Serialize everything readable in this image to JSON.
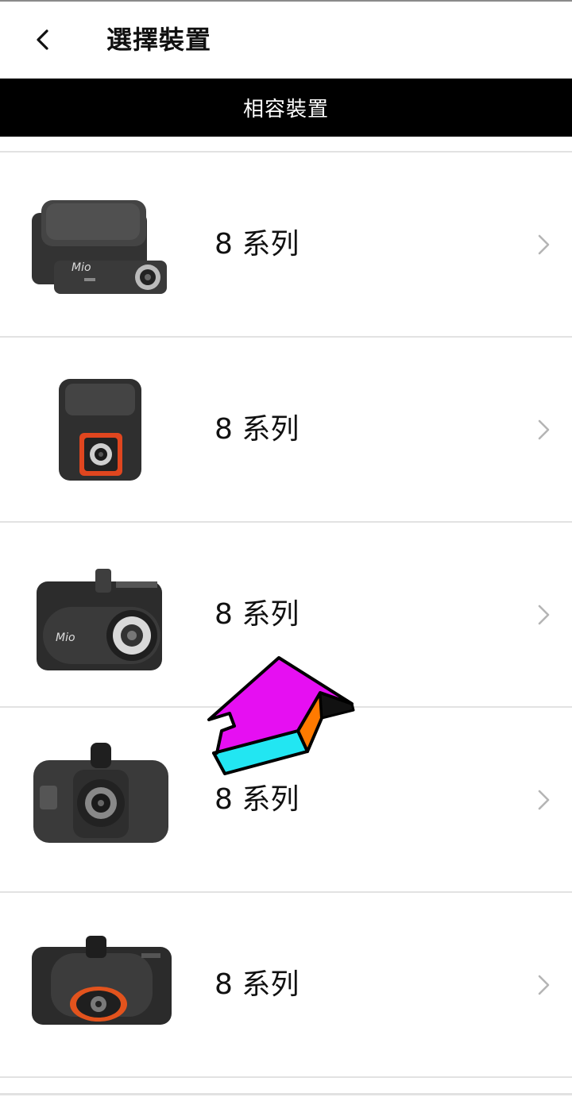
{
  "header": {
    "back_icon": "chevron-left-icon",
    "title": "選擇裝置"
  },
  "section": {
    "title": "相容裝置"
  },
  "devices": [
    {
      "label": "8 系列",
      "image": "dashcam-rear-camera-image",
      "chevron_icon": "chevron-right-icon"
    },
    {
      "label": "8 系列",
      "image": "dashcam-compact-orange-ring-image",
      "chevron_icon": "chevron-right-icon"
    },
    {
      "label": "8 系列",
      "image": "dashcam-wide-lens-gps-image",
      "chevron_icon": "chevron-right-icon"
    },
    {
      "label": "8 系列",
      "image": "dashcam-screen-mount-image",
      "chevron_icon": "chevron-right-icon"
    },
    {
      "label": "8 系列",
      "image": "dashcam-orange-accent-image",
      "chevron_icon": "chevron-right-icon"
    }
  ],
  "overlay": {
    "icon": "3d-up-arrow-icon",
    "colors": {
      "face": "#e60ff2",
      "side": "#ff7a00",
      "base": "#22e6f2",
      "outline": "#000000"
    }
  }
}
